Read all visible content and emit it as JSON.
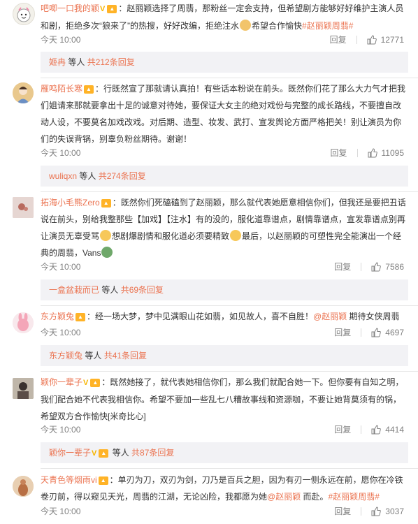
{
  "comments": [
    {
      "username": "吧唧一口我的颖",
      "has_v": true,
      "text_1": "：赵丽颖选择了周翡，那粉丝一定会支持，但希望剧方能够好好维护主演人员和剧，拒绝多次“狼来了”的热搜，好好改编，拒绝注水",
      "text_2": "希望合作愉快",
      "topic": "#赵丽颖周翡#",
      "time": "今天 10:00",
      "reply_label": "回复",
      "likes": "12771",
      "sub_user": "姬冉",
      "sub_mid": " 等人 ",
      "sub_count": "共212条回复"
    },
    {
      "username": "雁鸣陌长寒",
      "has_v": false,
      "text_1": "：行既然宣了那就请认真拍！有些话本粉说在前头。既然你们花了那么大力气才把我们姐请来那就要拿出十足的诚意对待她，要保证大女主的绝对戏份与完整的成长路线，不要擅自改动人设，不要莫名加戏改戏。对后期、造型、妆发、武打、宣发舆论方面严格把关！别让演员为你们的失误背锅，别辜负粉丝期待。谢谢！",
      "time": "今天 10:00",
      "reply_label": "回复",
      "likes": "11095",
      "sub_user": "wuliqxn",
      "sub_mid": " 等人 ",
      "sub_count": "共274条回复"
    },
    {
      "username": "拓海小毛熊Zero",
      "has_v": false,
      "text_1": "：既然你们死磕磕到了赵丽颖，那么就代表她愿意相信你们，但我还是要把丑话说在前头，别给我整那些【加戏】【注水】有的没的，服化道靠谱点，剧情靠谱点，宣发靠谱点别再让演员无辜受骂",
      "text_2": "想剧爆剧情和服化道必须要精致",
      "text_3": "最后，以赵丽颖的可塑性完全能演出一个经典的周翡，Vans",
      "time": "今天 10:00",
      "reply_label": "回复",
      "likes": "7586",
      "sub_user": "一盒盆栽而已",
      "sub_mid": " 等人 ",
      "sub_count": "共69条回复"
    },
    {
      "username": "东方颖兔",
      "has_v": false,
      "text_1": "：经一场大梦，梦中见满眼山花如翡，如见故人，喜不自胜！",
      "mention": "@赵丽颖",
      "text_2": " 期待女侠周翡",
      "time": "今天 10:00",
      "reply_label": "回复",
      "likes": "4697",
      "sub_user": "东方颖兔",
      "sub_mid": " 等人 ",
      "sub_count": "共41条回复"
    },
    {
      "username": "颖你一辈子",
      "has_v": true,
      "text_1": "：既然她接了，就代表她相信你们，那么我们就配合她一下。但你要有自知之明，我们配合她不代表我相信你。希望不要加一些乱七八糟故事线和资源咖，不要让她背莫须有的锅，希望双方合作愉快[米奇比心]",
      "time": "今天 10:00",
      "reply_label": "回复",
      "likes": "4414",
      "sub_user": "颖你一辈子",
      "sub_mid": " 等人 ",
      "sub_count": "共87条回复"
    },
    {
      "username": "天青色等烟雨vi",
      "has_v": false,
      "text_1": "：单刃为刀，双刃为剑，刀乃是百兵之胆，因为有刃一侧永远在前，愿你在冷铁卷刃前，得以窥见天光，周翡的江湖，无论凶险，我都愿为她",
      "mention": "@赵丽颖",
      "text_2": " 而赴。",
      "topic": "#赵丽颖周翡#",
      "time": "今天 10:00",
      "reply_label": "回复",
      "likes": "3037"
    }
  ]
}
